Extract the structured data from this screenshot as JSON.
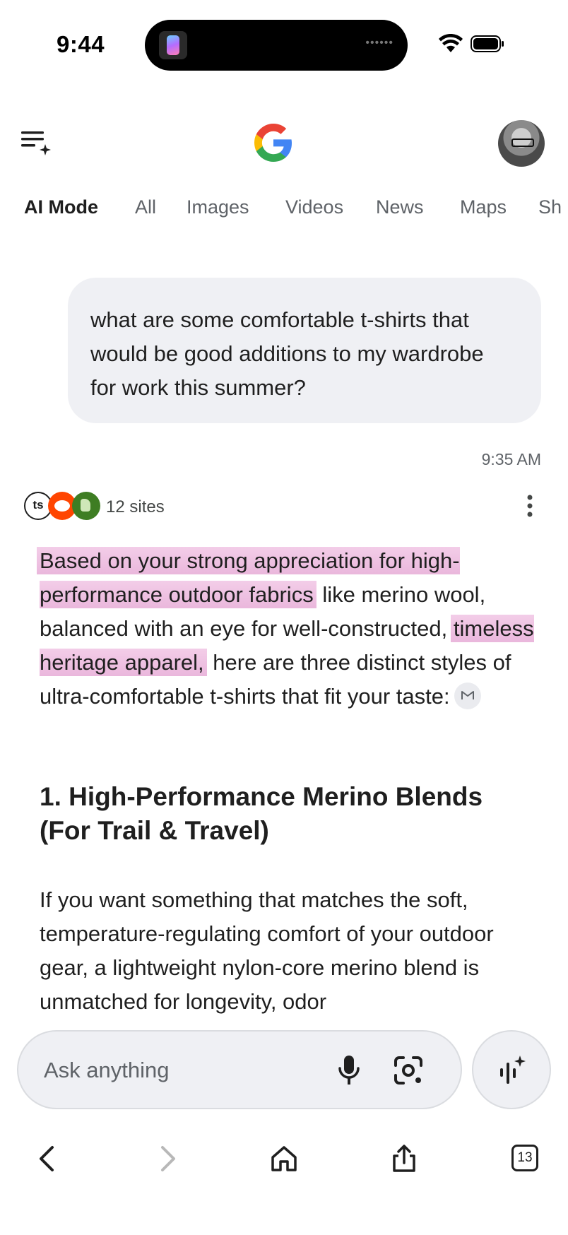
{
  "status_bar": {
    "time": "9:44"
  },
  "tabs": [
    {
      "label": "AI Mode",
      "active": true
    },
    {
      "label": "All"
    },
    {
      "label": "Images"
    },
    {
      "label": "Videos"
    },
    {
      "label": "News"
    },
    {
      "label": "Maps"
    },
    {
      "label": "Sh"
    }
  ],
  "conversation": {
    "user_message": "what are some comfortable t-shirts that would be good additions to my wardrobe for work this summer?",
    "timestamp": "9:35 AM",
    "sources": {
      "count_label": "12 sites",
      "icons": [
        "ts",
        "reddit-icon",
        "thumbs-up-icon"
      ]
    },
    "answer": {
      "intro_parts": [
        {
          "text": "Based on your strong appreciation for high-performance outdoor fabrics",
          "highlight": true
        },
        {
          "text": " like merino wool, balanced with an eye for well-constructed, ",
          "highlight": false
        },
        {
          "text": "timeless heritage apparel,",
          "highlight": true
        },
        {
          "text": " here are three distinct styles of ultra-comfortable t-shirts that fit your taste:",
          "highlight": false
        }
      ],
      "section_title": "1. High-Performance Merino Blends (For Trail & Travel)",
      "section_body": "If you want something that matches the soft, temperature-regulating comfort of your outdoor gear, a lightweight nylon-core merino blend is unmatched for longevity, odor"
    }
  },
  "composer": {
    "placeholder": "Ask anything"
  },
  "bottom_bar": {
    "tab_count": "13"
  },
  "colors": {
    "highlight": "#eab7dc",
    "bubble": "#eff0f4",
    "muted_text": "#5f6368"
  }
}
